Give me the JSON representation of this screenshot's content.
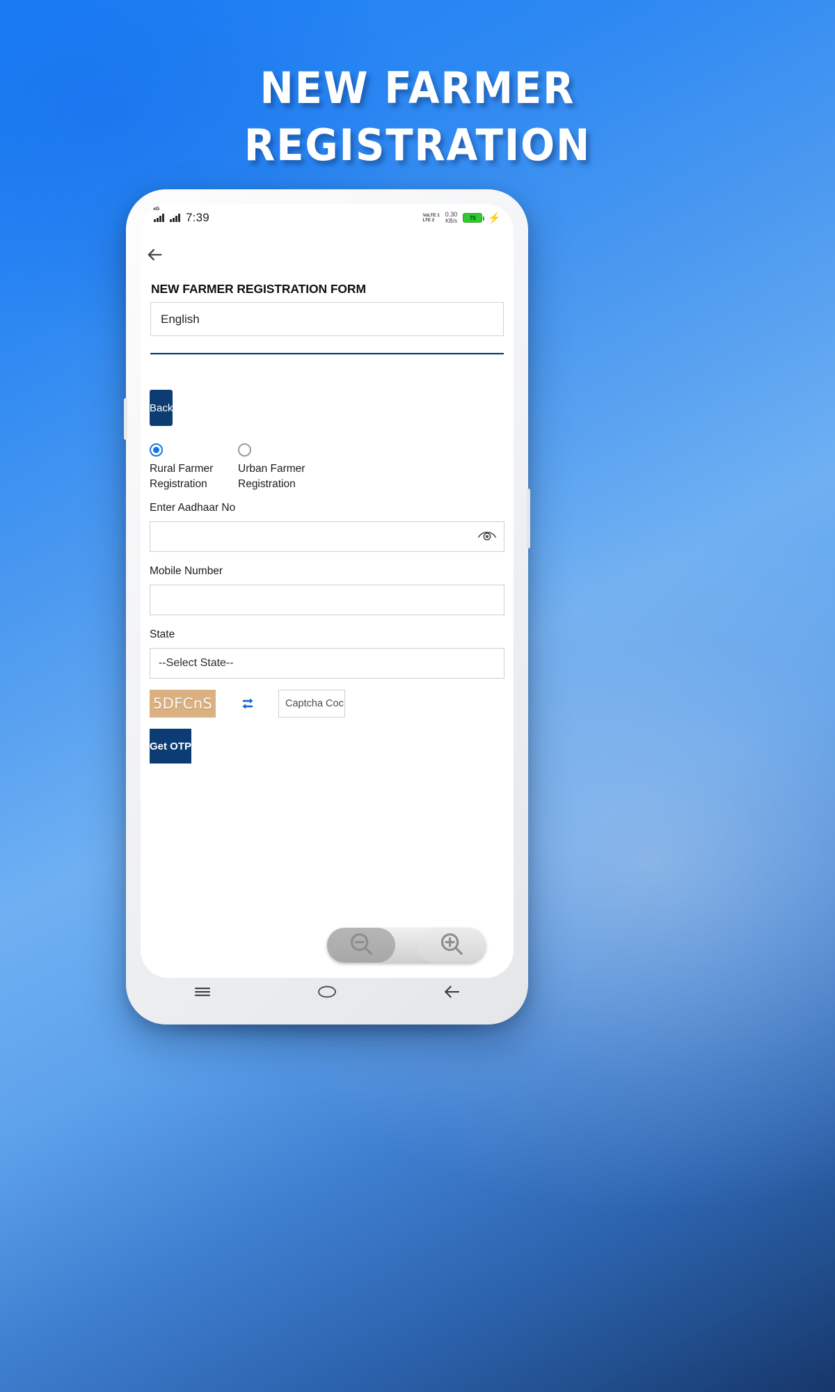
{
  "poster": {
    "title_line1": "NEW FARMER",
    "title_line2": "REGISTRATION",
    "bg_top_color": "#1a7ef5",
    "bg_bottom_color": "#17366a"
  },
  "status_bar": {
    "network_tag": "4G",
    "clock": "7:39",
    "volte_line1": "VoLTE 1",
    "volte_line2": "LTE 2",
    "net_speed_value": "0.30",
    "net_speed_unit": "KB/s",
    "battery_percent": "70",
    "charging_icon": "lightning-bolt-icon"
  },
  "app": {
    "back_icon": "back-arrow-icon",
    "form_title": "NEW FARMER REGISTRATION FORM",
    "language_select": {
      "value": "English",
      "options": [
        "English"
      ]
    },
    "back_button_label": "Back",
    "registration_type": [
      {
        "label": "Rural Farmer Registration",
        "selected": true
      },
      {
        "label": "Urban Farmer Registration",
        "selected": false
      }
    ],
    "aadhaar": {
      "label": "Enter Aadhaar No",
      "value": "",
      "placeholder": "",
      "toggle_icon": "eye-icon"
    },
    "mobile": {
      "label": "Mobile Number",
      "value": "",
      "placeholder": ""
    },
    "state": {
      "label": "State",
      "value": "--Select State--",
      "options": [
        "--Select State--"
      ]
    },
    "captcha": {
      "code": "5DFCnS",
      "refresh_icon": "refresh-icon",
      "input_placeholder": "Captcha Coc",
      "input_value": ""
    },
    "get_otp_button_label": "Get OTP",
    "footnote": ""
  },
  "zoom_control": {
    "zoom_out_icon": "magnifier-minus-icon",
    "zoom_in_icon": "magnifier-plus-icon"
  },
  "nav_bar": {
    "menu_icon": "hamburger-menu-icon",
    "home_icon": "home-pill-icon",
    "back_icon": "back-arrow-icon"
  },
  "colors": {
    "primary_navy": "#0c3c73",
    "accent_blue": "#1575e0",
    "captcha_bg": "#dcb182",
    "battery_green": "#2ecc2e"
  }
}
